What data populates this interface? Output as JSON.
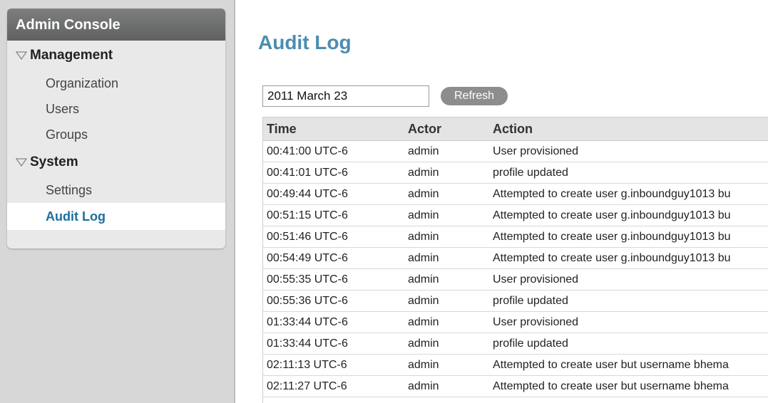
{
  "sidebar": {
    "title": "Admin Console",
    "sections": [
      {
        "label": "Management",
        "items": [
          "Organization",
          "Users",
          "Groups"
        ]
      },
      {
        "label": "System",
        "items": [
          "Settings",
          "Audit Log"
        ]
      }
    ],
    "active_item": "Audit Log"
  },
  "main": {
    "title": "Audit Log",
    "date_value": "2011 March 23",
    "refresh_label": "Refresh",
    "columns": [
      "Time",
      "Actor",
      "Action"
    ],
    "rows": [
      [
        "00:41:00 UTC-6",
        "admin",
        "User provisioned"
      ],
      [
        "00:41:01 UTC-6",
        "admin",
        "profile updated"
      ],
      [
        "00:49:44 UTC-6",
        "admin",
        "Attempted to create user g.inboundguy1013 bu"
      ],
      [
        "00:51:15 UTC-6",
        "admin",
        "Attempted to create user g.inboundguy1013 bu"
      ],
      [
        "00:51:46 UTC-6",
        "admin",
        "Attempted to create user g.inboundguy1013 bu"
      ],
      [
        "00:54:49 UTC-6",
        "admin",
        "Attempted to create user g.inboundguy1013 bu"
      ],
      [
        "00:55:35 UTC-6",
        "admin",
        "User provisioned"
      ],
      [
        "00:55:36 UTC-6",
        "admin",
        "profile updated"
      ],
      [
        "01:33:44 UTC-6",
        "admin",
        "User provisioned"
      ],
      [
        "01:33:44 UTC-6",
        "admin",
        "profile updated"
      ],
      [
        "02:11:13 UTC-6",
        "admin",
        "Attempted to create user but username bhema"
      ],
      [
        "02:11:27 UTC-6",
        "admin",
        "Attempted to create user but username bhema"
      ]
    ]
  },
  "colors": {
    "accent": "#4b8db0",
    "active_link": "#1c6f9c",
    "header_bg": "#6e6f6f",
    "sidebar_bg": "#e9e9e9",
    "button_bg": "#8d8d8d"
  },
  "icons": {
    "section_toggle": "triangle-down-outline-icon"
  }
}
